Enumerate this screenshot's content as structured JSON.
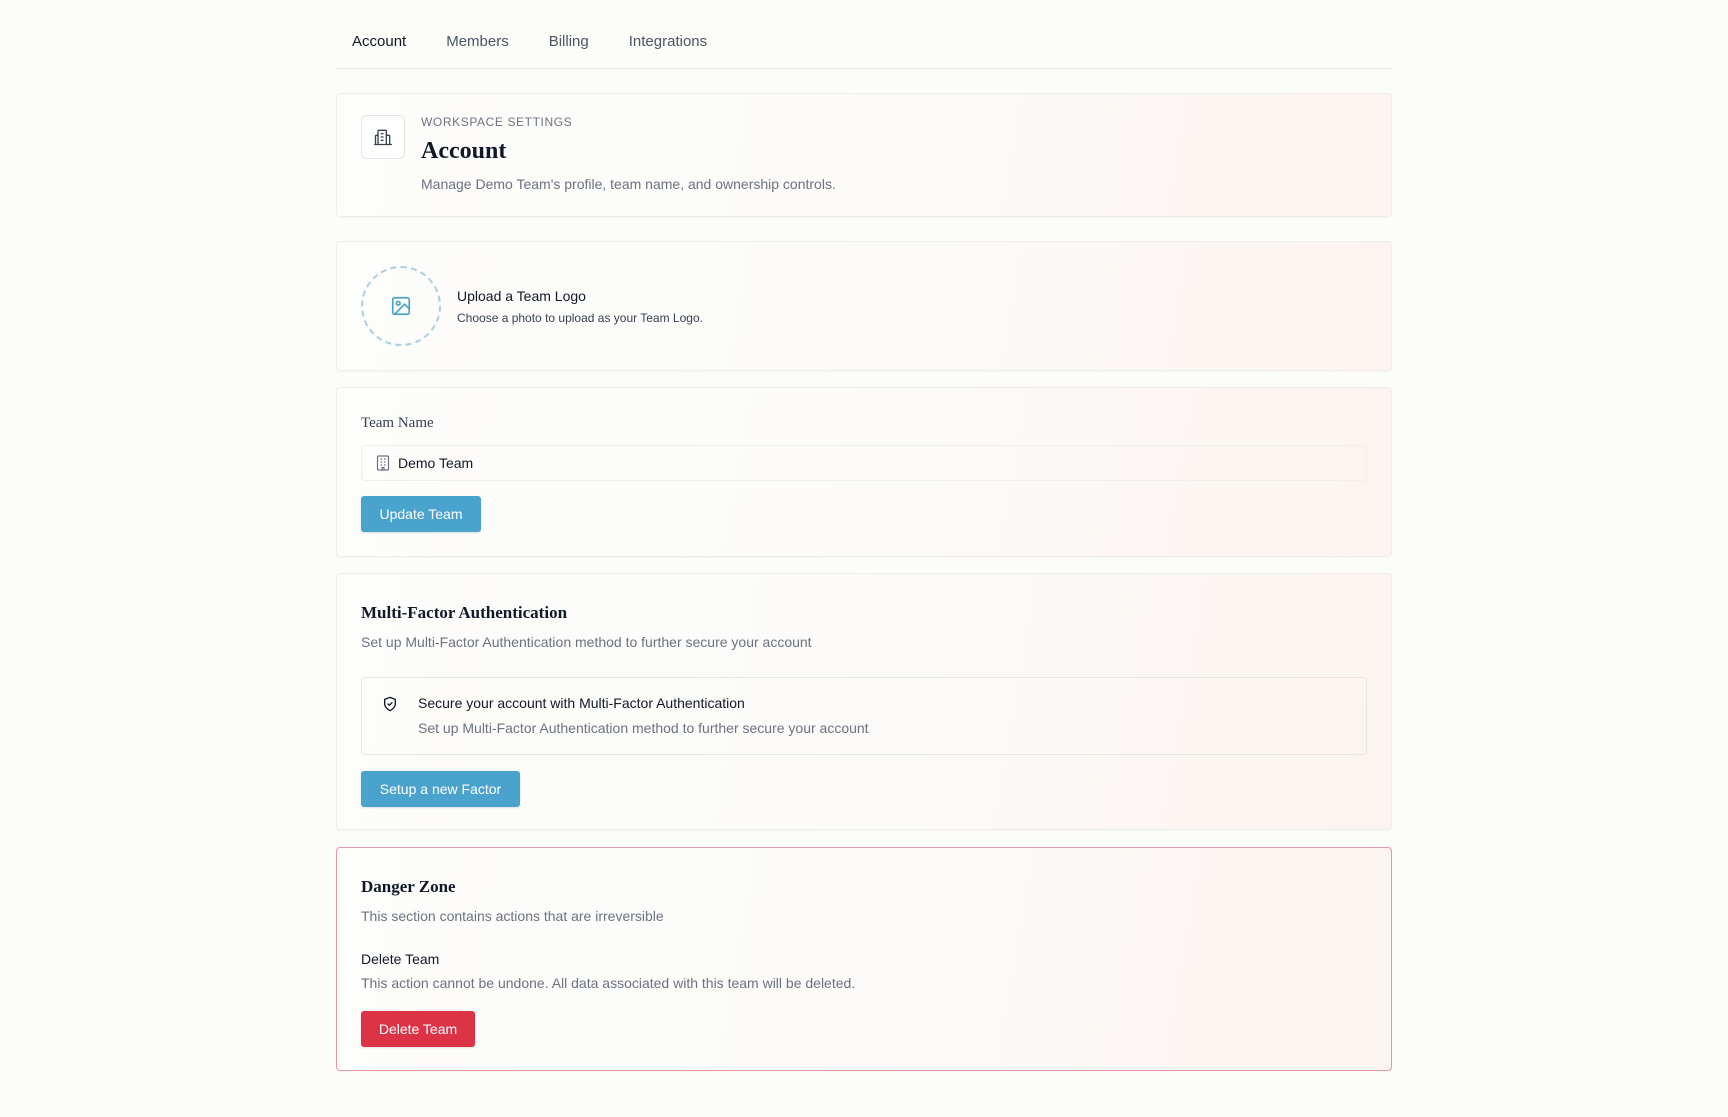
{
  "tabs": [
    {
      "label": "Account",
      "active": true
    },
    {
      "label": "Members",
      "active": false
    },
    {
      "label": "Billing",
      "active": false
    },
    {
      "label": "Integrations",
      "active": false
    }
  ],
  "header": {
    "eyebrow": "WORKSPACE SETTINGS",
    "title": "Account",
    "description": "Manage Demo Team's profile, team name, and ownership controls.",
    "icon": "building-icon"
  },
  "logo": {
    "title": "Upload a Team Logo",
    "description": "Choose a photo to upload as your Team Logo.",
    "icon": "image-icon"
  },
  "team": {
    "label": "Team Name",
    "value": "Demo Team",
    "button": "Update Team"
  },
  "mfa": {
    "title": "Multi-Factor Authentication",
    "description": "Set up Multi-Factor Authentication method to further secure your account",
    "box_title": "Secure your account with Multi-Factor Authentication",
    "box_description": "Set up Multi-Factor Authentication method to further secure your account",
    "button": "Setup a new Factor"
  },
  "danger": {
    "title": "Danger Zone",
    "description": "This section contains actions that are irreversible",
    "delete_title": "Delete Team",
    "delete_description": "This action cannot be undone. All data associated with this team will be deleted.",
    "button": "Delete Team"
  },
  "colors": {
    "primary": "#4aa3cc",
    "danger": "#dc3347",
    "danger_border": "#e49aa4",
    "background": "#fcfcf9"
  }
}
